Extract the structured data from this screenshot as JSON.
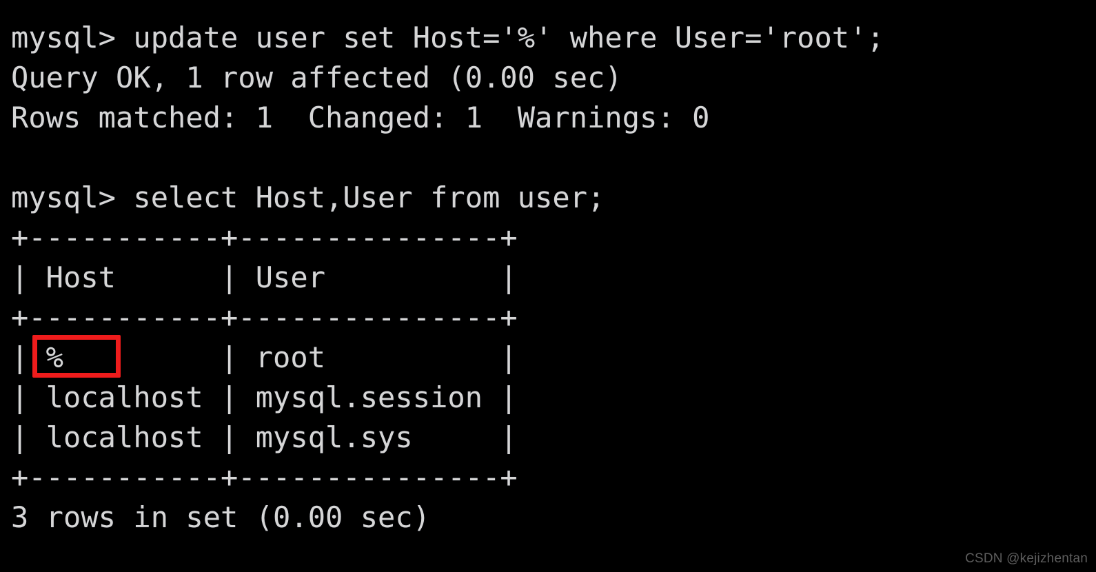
{
  "terminal": {
    "background_color": "#000000",
    "foreground_color": "#d6d6d6",
    "lines": [
      "mysql> update user set Host='%' where User='root';",
      "Query OK, 1 row affected (0.00 sec)",
      "Rows matched: 1  Changed: 1  Warnings: 0",
      "",
      "mysql> select Host,User from user;",
      "+-----------+---------------+",
      "| Host      | User          |",
      "+-----------+---------------+",
      "| %         | root          |",
      "| localhost | mysql.session |",
      "| localhost | mysql.sys     |",
      "+-----------+---------------+",
      "3 rows in set (0.00 sec)"
    ],
    "commands": {
      "update_statement": "mysql> update user set Host='%' where User='root';",
      "update_result": "Query OK, 1 row affected (0.00 sec)",
      "update_summary": "Rows matched: 1  Changed: 1  Warnings: 0",
      "select_statement": "mysql> select Host,User from user;",
      "select_result_count": "3 rows in set (0.00 sec)"
    },
    "result_table": {
      "top_border": "+-----------+---------------+",
      "header_row": "| Host      | User          |",
      "header_separator": "+-----------+---------------+",
      "bottom_border": "+-----------+---------------+",
      "columns": [
        "Host",
        "User"
      ],
      "rows": [
        {
          "host": "%",
          "user": "root",
          "text": "| %         | root          |"
        },
        {
          "host": "localhost",
          "user": "mysql.session",
          "text": "| localhost | mysql.session |"
        },
        {
          "host": "localhost",
          "user": "mysql.sys",
          "text": "| localhost | mysql.sys     |"
        }
      ],
      "row_count_label": "3 rows in set (0.00 sec)"
    }
  },
  "annotation": {
    "highlight_color": "#ef1c1c",
    "target_value": "%"
  },
  "watermark": {
    "text": "CSDN @kejizhentan",
    "color": "#5e5e5e"
  }
}
